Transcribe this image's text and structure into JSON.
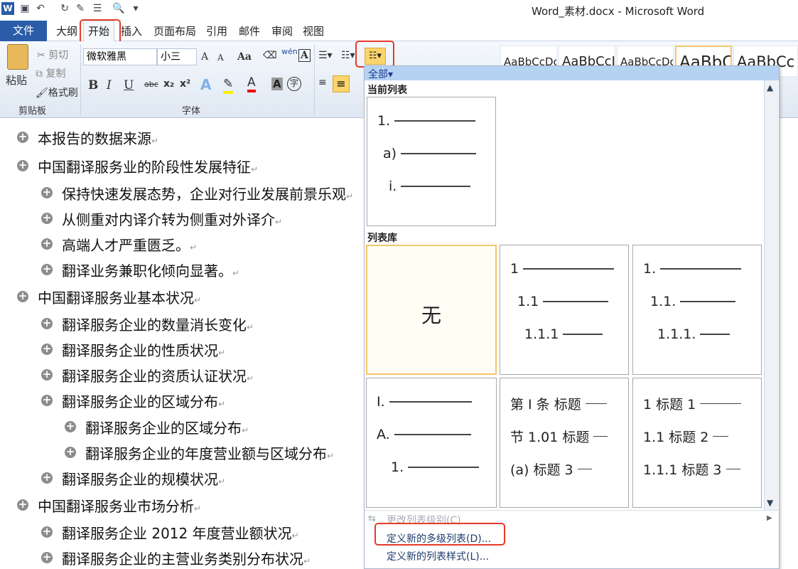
{
  "window": {
    "title": "Word_素材.docx - Microsoft Word",
    "app_icon": "W"
  },
  "quick_access": [
    "save-icon",
    "undo-icon",
    "redo-icon",
    "spelling-icon",
    "format-icon",
    "print-preview-icon",
    "customize-icon"
  ],
  "tabs": [
    "文件",
    "大纲",
    "开始",
    "插入",
    "页面布局",
    "引用",
    "邮件",
    "审阅",
    "视图"
  ],
  "ribbon": {
    "clipboard": {
      "paste": "粘贴",
      "cut": "剪切",
      "copy": "复制",
      "format_painter": "格式刷",
      "group": "剪贴板"
    },
    "font": {
      "name": "微软雅黑",
      "size": "小三",
      "group": "字体",
      "bold": "B",
      "italic": "I",
      "underline": "U",
      "strike": "abc",
      "sub": "x₂",
      "sup": "x²",
      "grow": "A",
      "shrink": "A",
      "case": "Aa",
      "wen": "wén",
      "char_border": "A",
      "text_effect": "A",
      "highlight": "✎",
      "font_color": "A",
      "shading": "A",
      "enclose": "字"
    },
    "styles": [
      "AaBbCcDc",
      "AaBbCcI",
      "AaBbCcDc",
      "AaBbC",
      "AaBbCc"
    ]
  },
  "document": {
    "items": [
      {
        "level": 1,
        "text": "本报告的数据来源"
      },
      {
        "level": 1,
        "text": "中国翻译服务业的阶段性发展特征"
      },
      {
        "level": 2,
        "text": "保持快速发展态势，企业对行业发展前景乐观"
      },
      {
        "level": 2,
        "text": "从侧重对内译介转为侧重对外译介"
      },
      {
        "level": 2,
        "text": "高端人才严重匮乏。"
      },
      {
        "level": 2,
        "text": "翻译业务兼职化倾向显著。"
      },
      {
        "level": 1,
        "text": "中国翻译服务业基本状况"
      },
      {
        "level": 2,
        "text": "翻译服务企业的数量消长变化"
      },
      {
        "level": 2,
        "text": "翻译服务企业的性质状况"
      },
      {
        "level": 2,
        "text": "翻译服务企业的资质认证状况"
      },
      {
        "level": 2,
        "text": "翻译服务企业的区域分布"
      },
      {
        "level": 3,
        "text": "翻译服务企业的区域分布"
      },
      {
        "level": 3,
        "text": "翻译服务企业的年度营业额与区域分布"
      },
      {
        "level": 2,
        "text": "翻译服务企业的规模状况"
      },
      {
        "level": 1,
        "text": "中国翻译服务业市场分析"
      },
      {
        "level": 2,
        "text": "翻译服务企业 2012 年度营业额状况"
      },
      {
        "level": 2,
        "text": "翻译服务企业的主营业务类别分布状况"
      }
    ],
    "paragraph_mark": "↵"
  },
  "multilevel_dropdown": {
    "filter": "全部",
    "current_section": "当前列表",
    "current_list": [
      "1.",
      "a)",
      "i."
    ],
    "library_section": "列表库",
    "library": [
      {
        "lines": [
          "无"
        ]
      },
      {
        "lines": [
          "1",
          "1.1",
          "1.1.1"
        ]
      },
      {
        "lines": [
          "1.",
          "1.1.",
          "1.1.1."
        ]
      },
      {
        "lines": [
          "I.",
          "A.",
          "1."
        ]
      },
      {
        "lines": [
          "第 I 条 标题",
          "节 1.01 标题",
          "(a) 标题 3"
        ]
      },
      {
        "lines": [
          "1 标题 1",
          "1.1 标题 2",
          "1.1.1 标题 3"
        ]
      }
    ],
    "menu": {
      "change_level": "更改列表级别(C)",
      "define_multilevel": "定义新的多级列表(D)...",
      "define_style": "定义新的列表样式(L)..."
    }
  }
}
